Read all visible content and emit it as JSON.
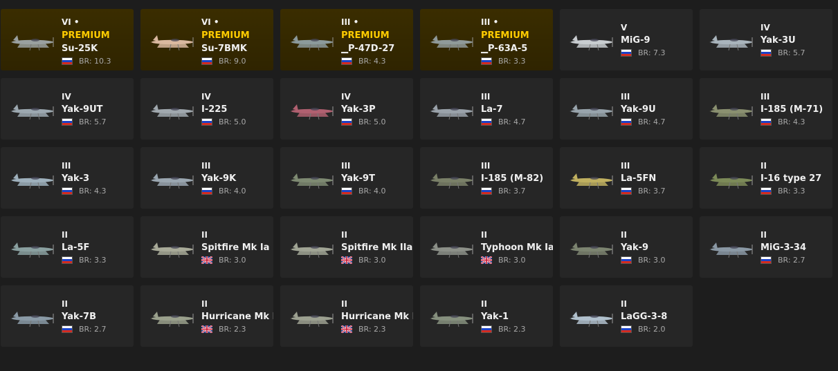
{
  "vehicles": [
    {
      "tier": "VI •",
      "premium": "PREMIUM",
      "name": "Su-25K",
      "flag": "ussr-flag-icon",
      "br": "BR: 10.3",
      "paint": "#9aa0a0"
    },
    {
      "tier": "VI •",
      "premium": "PREMIUM",
      "name": "Su-7BMK",
      "flag": "ussr-flag-icon",
      "br": "BR: 9.0",
      "paint": "#d9b8a0"
    },
    {
      "tier": "III •",
      "premium": "PREMIUM",
      "name": "▁P-47D-27",
      "flag": "ussr-flag-icon",
      "br": "BR: 4.3",
      "paint": "#8c9a9c"
    },
    {
      "tier": "III •",
      "premium": "PREMIUM",
      "name": "▁P-63A-5",
      "flag": "ussr-flag-icon",
      "br": "BR: 3.3",
      "paint": "#909a9a"
    },
    {
      "tier": "V",
      "name": "MiG-9",
      "flag": "ussr-flag-icon",
      "br": "BR: 7.3",
      "paint": "#c8ccd0"
    },
    {
      "tier": "IV",
      "name": "Yak-3U",
      "flag": "ussr-flag-icon",
      "br": "BR: 5.7",
      "paint": "#a9b4bc"
    },
    {
      "tier": "IV",
      "name": "Yak-9UT",
      "flag": "ussr-flag-icon",
      "br": "BR: 5.7",
      "paint": "#9ca8b0"
    },
    {
      "tier": "IV",
      "name": "I-225",
      "flag": "ussr-flag-icon",
      "br": "BR: 5.0",
      "paint": "#a0a8ae"
    },
    {
      "tier": "IV",
      "name": "Yak-3P",
      "flag": "ussr-flag-icon",
      "br": "BR: 5.0",
      "paint": "#b06070"
    },
    {
      "tier": "III",
      "name": "La-7",
      "flag": "ussr-flag-icon",
      "br": "BR: 4.7",
      "paint": "#9aa2aa"
    },
    {
      "tier": "III",
      "name": "Yak-9U",
      "flag": "ussr-flag-icon",
      "br": "BR: 4.7",
      "paint": "#98a4ac"
    },
    {
      "tier": "III",
      "name": "I-185 (M-71)",
      "flag": "ussr-flag-icon",
      "br": "BR: 4.3",
      "paint": "#8a9070"
    },
    {
      "tier": "III",
      "name": "Yak-3",
      "flag": "ussr-flag-icon",
      "br": "BR: 4.3",
      "paint": "#9eb0bc"
    },
    {
      "tier": "III",
      "name": "Yak-9K",
      "flag": "ussr-flag-icon",
      "br": "BR: 4.0",
      "paint": "#9aa6b0"
    },
    {
      "tier": "III",
      "name": "Yak-9T",
      "flag": "ussr-flag-icon",
      "br": "BR: 4.0",
      "paint": "#7e8a72"
    },
    {
      "tier": "III",
      "name": "I-185 (M-82)",
      "flag": "ussr-flag-icon",
      "br": "BR: 3.7",
      "paint": "#7a8068"
    },
    {
      "tier": "III",
      "name": "La-5FN",
      "flag": "ussr-flag-icon",
      "br": "BR: 3.7",
      "paint": "#c0b060"
    },
    {
      "tier": "II",
      "name": "I-16 type 27",
      "flag": "ussr-flag-icon",
      "br": "BR: 3.3",
      "paint": "#7c8a58"
    },
    {
      "tier": "II",
      "name": "La-5F",
      "flag": "ussr-flag-icon",
      "br": "BR: 3.3",
      "paint": "#8aa0a0"
    },
    {
      "tier": "II",
      "name": "Spitfire Mk Ia",
      "flag": "uk-flag-icon",
      "br": "BR: 3.0",
      "paint": "#a8aa98"
    },
    {
      "tier": "II",
      "name": "Spitfire Mk IIa",
      "flag": "uk-flag-icon",
      "br": "BR: 3.0",
      "paint": "#a0a494"
    },
    {
      "tier": "II",
      "name": "Typhoon Mk Ia",
      "flag": "uk-flag-icon",
      "br": "BR: 3.0",
      "paint": "#8c9088"
    },
    {
      "tier": "II",
      "name": "Yak-9",
      "flag": "ussr-flag-icon",
      "br": "BR: 3.0",
      "paint": "#7c8470"
    },
    {
      "tier": "II",
      "name": "MiG-3-34",
      "flag": "ussr-flag-icon",
      "br": "BR: 2.7",
      "paint": "#8a98a4"
    },
    {
      "tier": "II",
      "name": "Yak-7B",
      "flag": "ussr-flag-icon",
      "br": "BR: 2.7",
      "paint": "#8a9aa6"
    },
    {
      "tier": "II",
      "name": "Hurricane Mk I/L",
      "flag": "uk-flag-icon",
      "br": "BR: 2.3",
      "paint": "#9aa08c"
    },
    {
      "tier": "II",
      "name": "Hurricane Mk IIB",
      "flag": "uk-flag-icon",
      "br": "BR: 2.3",
      "paint": "#9ca090"
    },
    {
      "tier": "II",
      "name": "Yak-1",
      "flag": "ussr-flag-icon",
      "br": "BR: 2.3",
      "paint": "#86907e"
    },
    {
      "tier": "II",
      "name": "LaGG-3-8",
      "flag": "ussr-flag-icon",
      "br": "BR: 2.0",
      "paint": "#b0c0cc"
    }
  ]
}
